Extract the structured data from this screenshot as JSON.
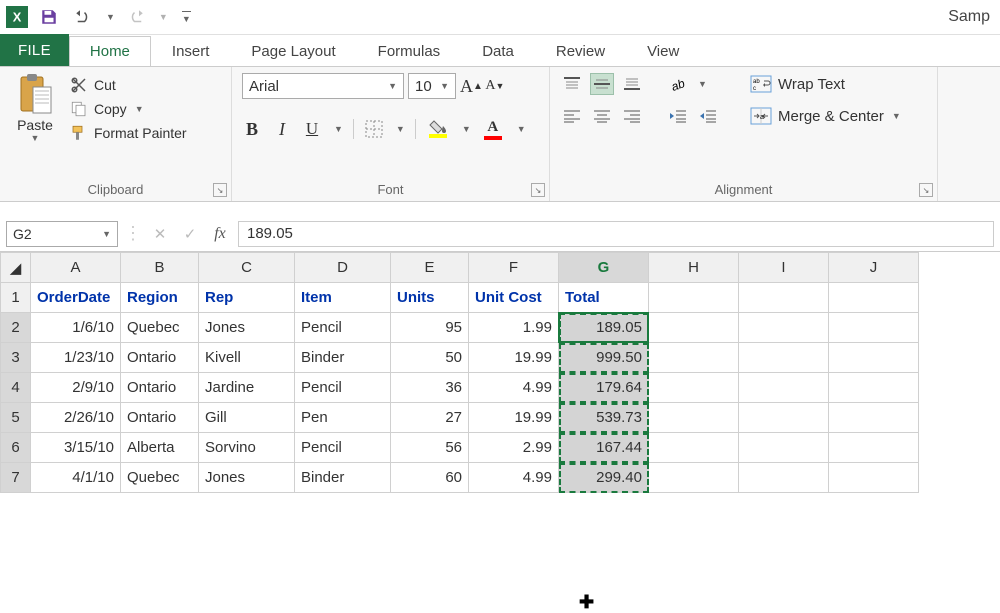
{
  "titlebar": {
    "title": "Samp"
  },
  "tabs": {
    "file": "FILE",
    "list": [
      "Home",
      "Insert",
      "Page Layout",
      "Formulas",
      "Data",
      "Review",
      "View"
    ],
    "active": 0
  },
  "clipboard": {
    "paste": "Paste",
    "cut": "Cut",
    "copy": "Copy",
    "fmtpaint": "Format Painter",
    "label": "Clipboard"
  },
  "font": {
    "name": "Arial",
    "size": "10",
    "label": "Font"
  },
  "alignment": {
    "wrap": "Wrap Text",
    "merge": "Merge & Center",
    "label": "Alignment"
  },
  "formula_bar": {
    "cellref": "G2",
    "value": "189.05"
  },
  "sheet": {
    "columns": [
      "A",
      "B",
      "C",
      "D",
      "E",
      "F",
      "G",
      "H",
      "I",
      "J"
    ],
    "headers": [
      "OrderDate",
      "Region",
      "Rep",
      "Item",
      "Units",
      "Unit Cost",
      "Total"
    ],
    "rows": [
      {
        "n": "1"
      },
      {
        "n": "2",
        "d": "1/6/10",
        "r": "Quebec",
        "rep": "Jones",
        "item": "Pencil",
        "u": "95",
        "uc": "1.99",
        "t": "189.05"
      },
      {
        "n": "3",
        "d": "1/23/10",
        "r": "Ontario",
        "rep": "Kivell",
        "item": "Binder",
        "u": "50",
        "uc": "19.99",
        "t": "999.50"
      },
      {
        "n": "4",
        "d": "2/9/10",
        "r": "Ontario",
        "rep": "Jardine",
        "item": "Pencil",
        "u": "36",
        "uc": "4.99",
        "t": "179.64"
      },
      {
        "n": "5",
        "d": "2/26/10",
        "r": "Ontario",
        "rep": "Gill",
        "item": "Pen",
        "u": "27",
        "uc": "19.99",
        "t": "539.73"
      },
      {
        "n": "6",
        "d": "3/15/10",
        "r": "Alberta",
        "rep": "Sorvino",
        "item": "Pencil",
        "u": "56",
        "uc": "2.99",
        "t": "167.44"
      },
      {
        "n": "7",
        "d": "4/1/10",
        "r": "Quebec",
        "rep": "Jones",
        "item": "Binder",
        "u": "60",
        "uc": "4.99",
        "t": "299.40"
      }
    ],
    "selected_col": "G",
    "selected_range": "G2:G7",
    "active_cell": "G2"
  }
}
